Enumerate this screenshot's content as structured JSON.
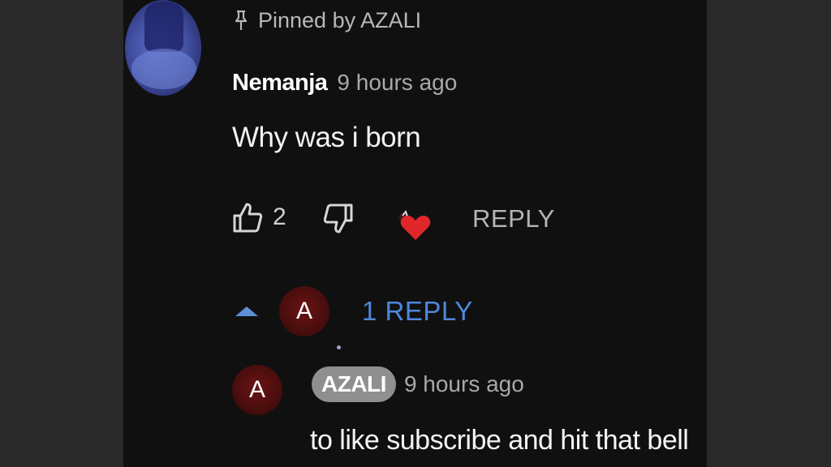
{
  "pinned": {
    "label": "Pinned by AZALI"
  },
  "comment": {
    "author": "Nemanja",
    "timestamp": "9 hours ago",
    "text": "Why was i born",
    "like_count": "2",
    "reply_label": "REPLY"
  },
  "replies": {
    "toggle_label": "1 REPLY",
    "avatar_letter": "A"
  },
  "reply": {
    "avatar_letter": "A",
    "author": "AZALI",
    "timestamp": "9 hours ago",
    "text": "to like subscribe and hit that bell"
  },
  "colors": {
    "accent_blue": "#4e87dc",
    "heart_red": "#e0262a",
    "avatar_red": "#5a1010",
    "chip_grey": "#8f8f8f"
  },
  "icons": [
    "pin-icon",
    "thumb-up-icon",
    "thumb-down-icon",
    "creator-heart-icon",
    "caret-up-icon"
  ]
}
